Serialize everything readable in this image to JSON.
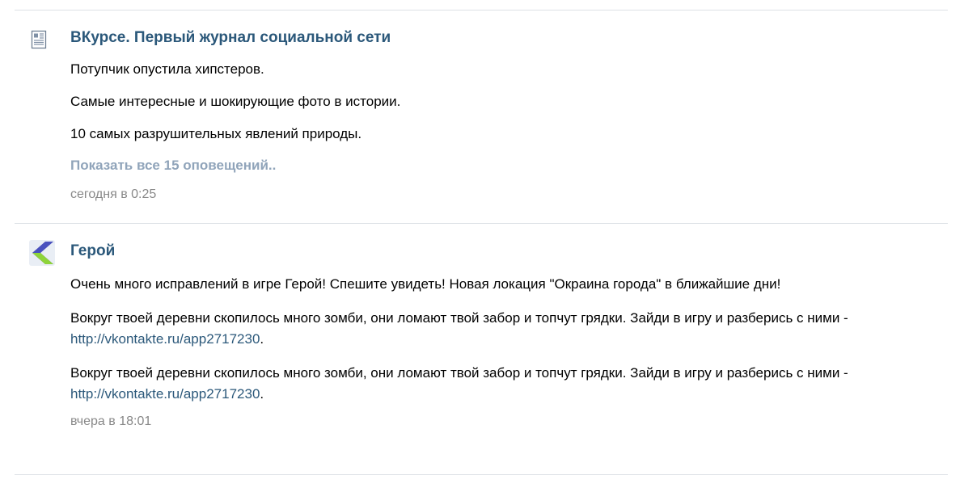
{
  "feed": {
    "blocks": [
      {
        "icon": "newspaper-icon",
        "title": "ВКурсе. Первый журнал социальной сети",
        "items": [
          "Потупчик опустила хипстеров.",
          "Самые интересные и шокирующие фото в истории.",
          "10 самых разрушительных явлений природы."
        ],
        "show_all": "Показать все 15 оповещений..",
        "timestamp": "сегодня в 0:25"
      },
      {
        "icon": "hero-app-icon",
        "title": "Герой",
        "items": [
          {
            "text": "Очень много исправлений в игре Герой! Спешите увидеть! Новая локация \"Окраина города\" в ближайшие дни!"
          },
          {
            "text": "Вокруг твоей деревни скопилось много зомби, они ломают твой забор и топчут грядки. Зайди в игру и разберись с ними - ",
            "link": "http://vkontakte.ru/app2717230",
            "suffix": "."
          },
          {
            "text": "Вокруг твоей деревни скопилось много зомби, они ломают твой забор и топчут грядки. Зайди в игру и разберись с ними - ",
            "link": "http://vkontakte.ru/app2717230",
            "suffix": "."
          }
        ],
        "timestamp": "вчера в 18:01"
      }
    ]
  },
  "colors": {
    "title_link": "#2b587a",
    "show_all": "#90a4ba",
    "timestamp": "#888888",
    "divider": "#dde1e6",
    "hero_icon_purple": "#5b2d9e",
    "hero_icon_green": "#8ed43a",
    "hero_icon_blue": "#3a6fd8"
  }
}
